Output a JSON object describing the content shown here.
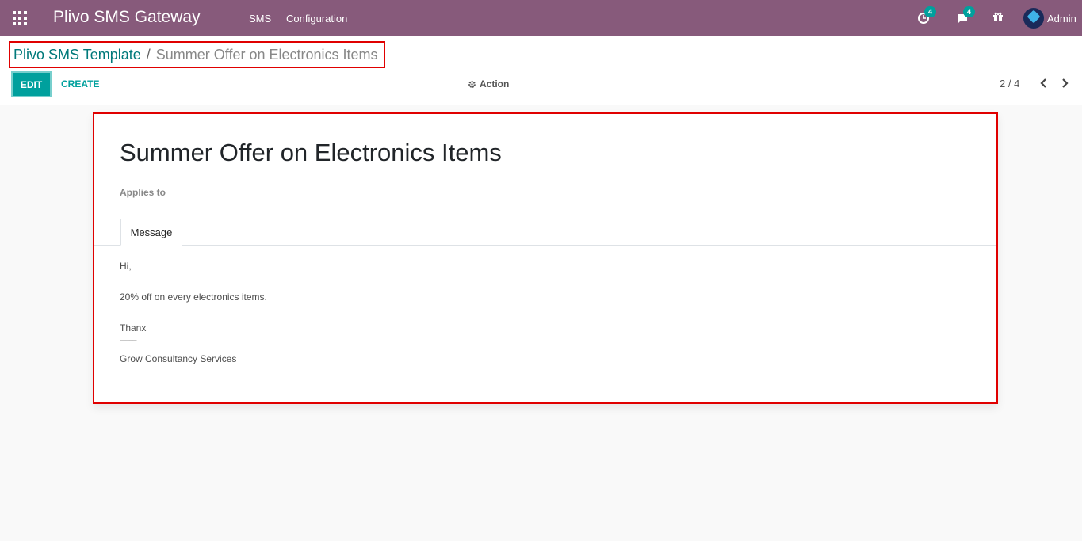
{
  "navbar": {
    "app_title": "Plivo SMS Gateway",
    "menu": [
      "SMS",
      "Configuration"
    ],
    "activity_count": "4",
    "message_count": "4",
    "user_name": "Admin"
  },
  "breadcrumb": {
    "parent": "Plivo SMS Template",
    "separator": "/",
    "current": "Summer Offer on Electronics Items"
  },
  "toolbar": {
    "edit_label": "EDIT",
    "create_label": "CREATE",
    "action_label": "Action",
    "pager": "2 / 4"
  },
  "record": {
    "name": "Summer Offer on Electronics Items",
    "applies_to_label": "Applies to",
    "tab_label": "Message",
    "message_lines": [
      "Hi,",
      "20% off on every electronics items.",
      "Thanx",
      "---------",
      "Grow Consultancy Services"
    ]
  },
  "colors": {
    "navbar": "#875a7b",
    "primary": "#00a09d",
    "highlight": "#e00000"
  }
}
